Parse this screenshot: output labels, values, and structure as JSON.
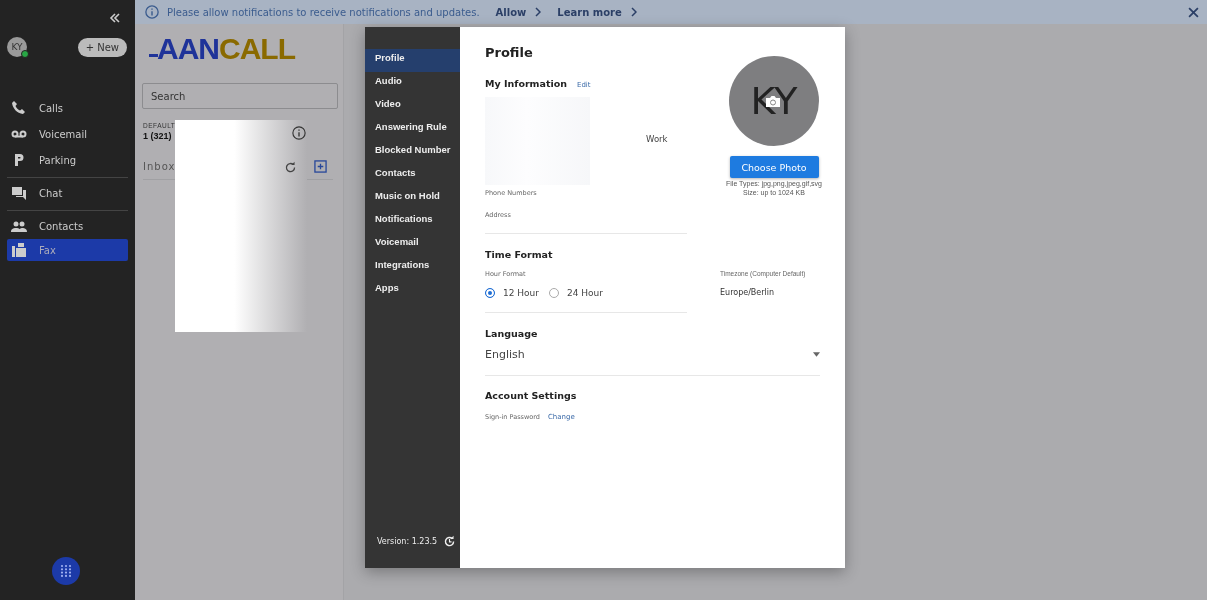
{
  "sidebar": {
    "avatar": "KY",
    "online": true,
    "new_button": "+ New",
    "items": [
      {
        "label": "Calls",
        "selected": false
      },
      {
        "label": "Voicemail",
        "selected": false
      },
      {
        "label": "Parking",
        "selected": false
      },
      {
        "label": "Chat",
        "selected": false
      },
      {
        "label": "Contacts",
        "selected": false
      },
      {
        "label": "Fax",
        "selected": true
      }
    ]
  },
  "notification": {
    "message": "Please allow notifications to receive notifications and updates.",
    "actions": [
      "Allow",
      "Learn more"
    ]
  },
  "fax_panel": {
    "logo_left": "AAN",
    "logo_right": "CALL",
    "search_placeholder": "Search",
    "default_label": "DEFAULT",
    "number": "1 (321)",
    "folder": "Inbox"
  },
  "settings_nav": {
    "items": [
      {
        "label": "Profile",
        "selected": true
      },
      {
        "label": "Audio",
        "selected": false
      },
      {
        "label": "Video",
        "selected": false
      },
      {
        "label": "Answering Rule",
        "selected": false
      },
      {
        "label": "Blocked Number",
        "selected": false
      },
      {
        "label": "Contacts",
        "selected": false
      },
      {
        "label": "Music on Hold",
        "selected": false
      },
      {
        "label": "Notifications",
        "selected": false
      },
      {
        "label": "Voicemail",
        "selected": false
      },
      {
        "label": "Integrations",
        "selected": false
      },
      {
        "label": "Apps",
        "selected": false
      }
    ],
    "version": "Version: 1.23.5"
  },
  "profile": {
    "title": "Profile",
    "my_info": {
      "heading": "My Information",
      "edit": "Edit",
      "email_type": "Work",
      "phone_label": "Phone Numbers",
      "address_label": "Address"
    },
    "photo": {
      "initials": "KY",
      "button": "Choose Photo",
      "hints": [
        "File Types: jpg,png,jpeg,gif,svg",
        "Size: up to 1024 KB"
      ]
    },
    "time_format": {
      "heading": "Time Format",
      "hour_label": "Hour Format",
      "options": [
        {
          "label": "12 Hour",
          "selected": true
        },
        {
          "label": "24 Hour",
          "selected": false
        }
      ],
      "timezone_label": "Timezone (Computer Default)",
      "timezone": "Europe/Berlin"
    },
    "language": {
      "heading": "Language",
      "value": "English"
    },
    "account": {
      "heading": "Account Settings",
      "password_label": "Sign-in Password",
      "change": "Change"
    }
  }
}
